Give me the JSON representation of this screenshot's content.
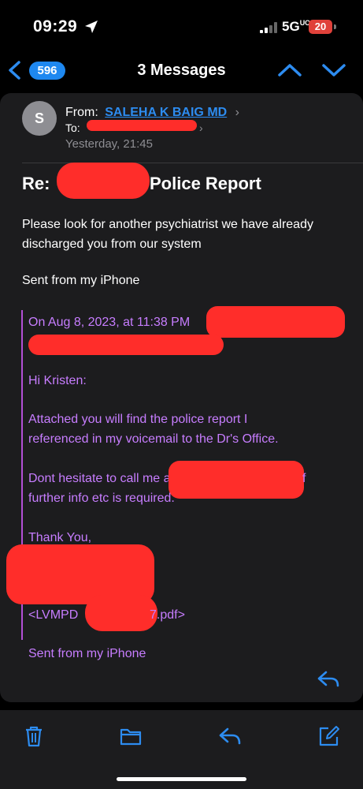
{
  "status_bar": {
    "time": "09:29",
    "network": "5G",
    "network_suffix": "UC",
    "battery": "20"
  },
  "nav": {
    "back_badge": "596",
    "title": "3 Messages"
  },
  "message": {
    "avatar_initial": "S",
    "from_label": "From:",
    "from_name": "SALEHA K BAIG MD",
    "to_label": "To:",
    "date": "Yesterday, 21:45",
    "subject_prefix": "Re:",
    "subject_suffix": "Police Report",
    "body_line1": "Please look for another psychiatrist we have already discharged you from our system",
    "body_sent_from": "Sent from my iPhone",
    "quoted": {
      "header": "On Aug 8, 2023, at 11:38 PM",
      "greeting": "Hi Kristen:",
      "para1_line1": "Attached you will find the police report I",
      "para1_line2": "referenced in my voicemail to the Dr's Office.",
      "para2_line1": "Dont hesitate to call me a",
      "para2_line1_end": "f",
      "para2_line2": "further info etc is required.",
      "thanks": "Thank You,",
      "attachment_start": "<LVMPD",
      "attachment_end": "7.pdf>",
      "sent_from": "Sent from my iPhone"
    }
  },
  "colors": {
    "accent": "#2d8cf0",
    "quote": "#c77dff",
    "redaction": "#ff2d2a",
    "battery": "#e0413a"
  },
  "icons": [
    "location-arrow-icon",
    "signal-icon",
    "back-chevron-icon",
    "up-chevron-icon",
    "down-chevron-icon",
    "reply-icon",
    "trash-icon",
    "folder-icon",
    "compose-icon"
  ]
}
